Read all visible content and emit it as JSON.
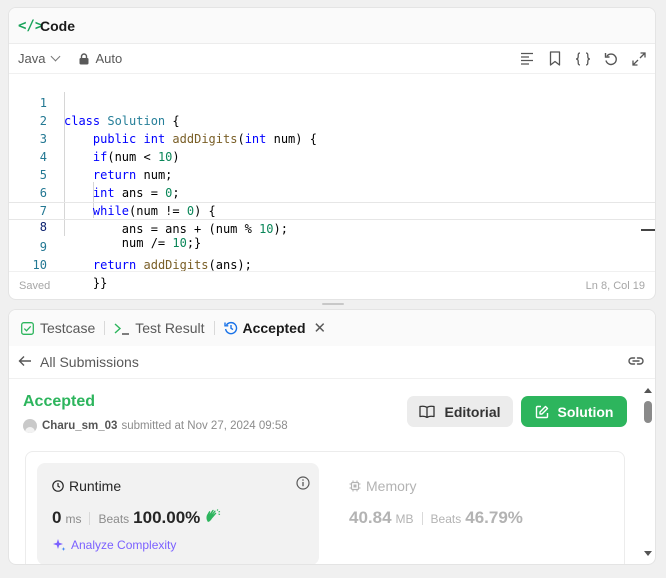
{
  "code_panel": {
    "title": "Code",
    "language": "Java",
    "mode": "Auto",
    "toolbar_icons": [
      "format-icon",
      "bookmark-icon",
      "braces-icon",
      "reset-icon",
      "expand-icon"
    ],
    "lines": [
      {
        "n": "1",
        "text": "class Solution {"
      },
      {
        "n": "2",
        "text": "    public int addDigits(int num) {"
      },
      {
        "n": "3",
        "text": "    if(num < 10)"
      },
      {
        "n": "4",
        "text": "    return num;"
      },
      {
        "n": "5",
        "text": "    int ans = 0;"
      },
      {
        "n": "6",
        "text": "    while(num != 0) {"
      },
      {
        "n": "7",
        "text": "        ans = ans + (num % 10);"
      },
      {
        "n": "8",
        "text": "        num /= 10;}"
      },
      {
        "n": "9",
        "text": "    return addDigits(ans);"
      },
      {
        "n": "10",
        "text": "    }}"
      }
    ],
    "status_left": "Saved",
    "status_right": "Ln 8, Col 19"
  },
  "result_panel": {
    "tabs": [
      {
        "label": "Testcase",
        "icon": "checkbox-icon"
      },
      {
        "label": "Test Result",
        "icon": "terminal-icon"
      },
      {
        "label": "Accepted",
        "icon": "history-icon"
      }
    ],
    "back_label": "All Submissions",
    "status_title": "Accepted",
    "username": "Charu_sm_03",
    "submitted_text": "submitted at Nov 27, 2024 09:58",
    "editorial_label": "Editorial",
    "solution_label": "Solution",
    "runtime": {
      "title": "Runtime",
      "value": "0",
      "unit": "ms",
      "beats_label": "Beats",
      "beats_value": "100.00%",
      "analyze_label": "Analyze Complexity"
    },
    "memory": {
      "title": "Memory",
      "value": "40.84",
      "unit": "MB",
      "beats_label": "Beats",
      "beats_value": "46.79%"
    }
  },
  "colors": {
    "accent_green": "#2db55d",
    "analyze_purple": "#7b61ff"
  }
}
